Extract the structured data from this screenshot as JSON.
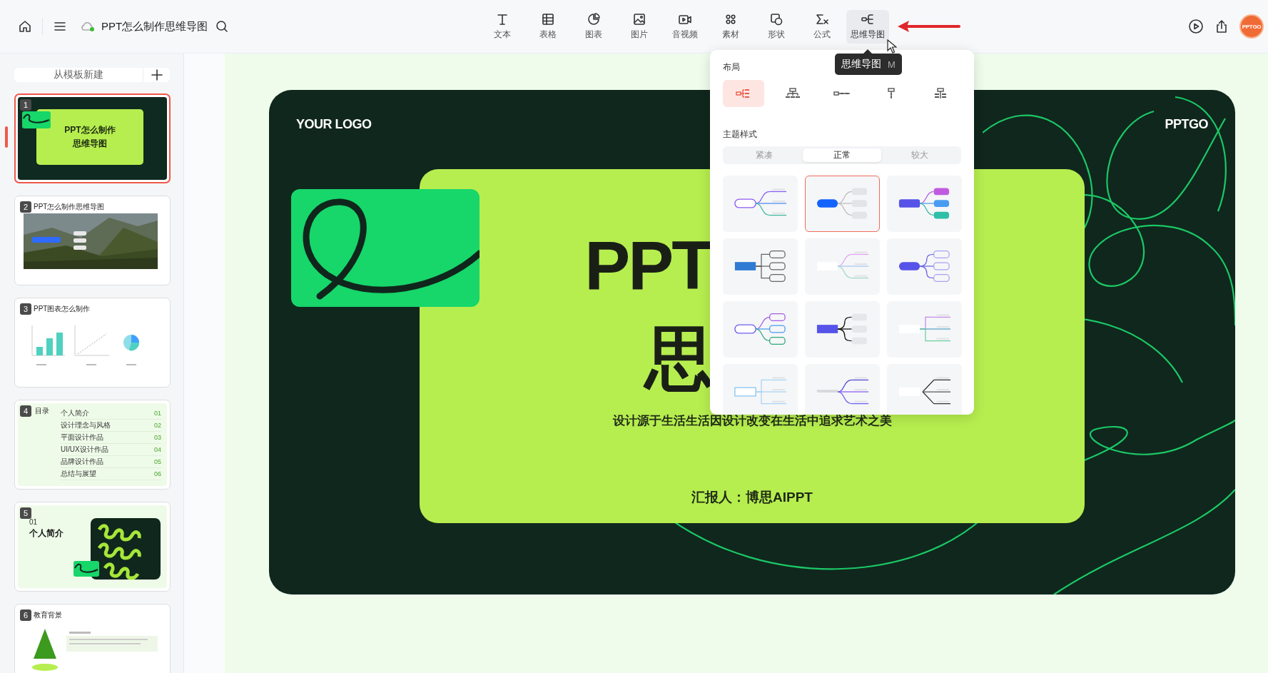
{
  "header": {
    "title": "PPT怎么制作思维导图"
  },
  "toolbar": [
    {
      "label": "文本",
      "selected": false
    },
    {
      "label": "表格",
      "selected": false
    },
    {
      "label": "图表",
      "selected": false
    },
    {
      "label": "图片",
      "selected": false
    },
    {
      "label": "音视频",
      "selected": false
    },
    {
      "label": "素材",
      "selected": false
    },
    {
      "label": "形状",
      "selected": false
    },
    {
      "label": "公式",
      "selected": false
    },
    {
      "label": "思维导图",
      "selected": true
    }
  ],
  "tooltip": {
    "label": "思维导图",
    "shortcut": "M"
  },
  "avatar": {
    "text": "PPTGO"
  },
  "sidebar": {
    "new_button": "从模板新建",
    "slides": [
      {
        "number": "1",
        "selected": true,
        "kind": "title",
        "lines": [
          "PPT怎么制作",
          "思维导图"
        ]
      },
      {
        "number": "2",
        "selected": false,
        "title": "PPT怎么制作思维导图"
      },
      {
        "number": "3",
        "selected": false,
        "kind": "charts",
        "title": "PPT图表怎么制作"
      },
      {
        "number": "4",
        "selected": false,
        "kind": "contents",
        "title": "目录",
        "items": [
          {
            "label": "个人简介",
            "number": "01"
          },
          {
            "label": "设计理念与风格",
            "number": "02"
          },
          {
            "label": "平面设计作品",
            "number": "03"
          },
          {
            "label": "UI/UX设计作品",
            "number": "04"
          },
          {
            "label": "品牌设计作品",
            "number": "05"
          },
          {
            "label": "总结与展望",
            "number": "06"
          }
        ]
      },
      {
        "number": "5",
        "selected": false,
        "kind": "section",
        "section_number": "01",
        "title": "个人简介"
      },
      {
        "number": "6",
        "selected": false,
        "kind": "education",
        "title": "教育背景"
      }
    ]
  },
  "slide": {
    "logo": "YOUR LOGO",
    "brand": "PPTGO",
    "title_lines": [
      "PPT",
      "思"
    ],
    "subtitle": "设计源于生活生活因设计改变在生活中追求艺术之美",
    "presenter": "汇报人：博思AIPPT"
  },
  "mindmap_panel": {
    "layout_label": "布局",
    "layouts": [
      {
        "kind": "right",
        "selected": true
      },
      {
        "kind": "org",
        "selected": false
      },
      {
        "kind": "horizontal",
        "selected": false
      },
      {
        "kind": "vertical",
        "selected": false
      },
      {
        "kind": "tree",
        "selected": false
      }
    ],
    "theme_label": "主题样式",
    "sizes": [
      {
        "label": "紧凑",
        "selected": false
      },
      {
        "label": "正常",
        "selected": true
      },
      {
        "label": "较大",
        "selected": false
      }
    ],
    "themes": [
      {
        "kind": "outline",
        "selected": false
      },
      {
        "kind": "solid",
        "selected": true
      },
      {
        "kind": "colorful",
        "selected": false
      },
      {
        "kind": "org",
        "selected": false
      },
      {
        "kind": "faint",
        "selected": false
      },
      {
        "kind": "bubble",
        "selected": false
      },
      {
        "kind": "outline-colorful",
        "selected": false
      },
      {
        "kind": "bracket",
        "selected": false
      },
      {
        "kind": "faint-lines",
        "selected": false
      },
      {
        "kind": "light",
        "selected": false
      },
      {
        "kind": "underline",
        "selected": false
      },
      {
        "kind": "plain",
        "selected": false
      }
    ]
  }
}
